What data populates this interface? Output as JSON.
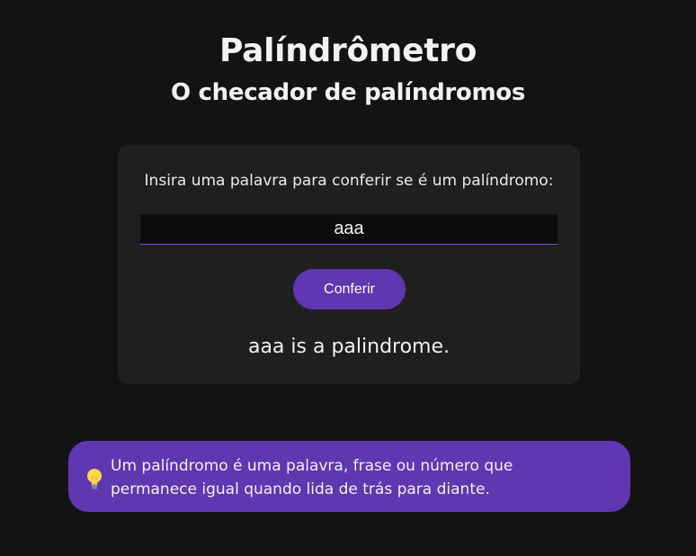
{
  "header": {
    "title": "Palíndrômetro",
    "subtitle": "O checador de palíndromos"
  },
  "checker": {
    "prompt": "Insira uma palavra para conferir se é um palíndromo:",
    "input_value": "aaa",
    "button_label": "Conferir",
    "result_text": "aaa is a palindrome."
  },
  "info": {
    "icon": "lightbulb-icon",
    "text": "Um palíndromo é uma palavra, frase ou número que permanece igual quando lida de trás para diante."
  },
  "colors": {
    "background": "#131313",
    "card": "#1f1f1f",
    "accent": "#5f37b1"
  }
}
